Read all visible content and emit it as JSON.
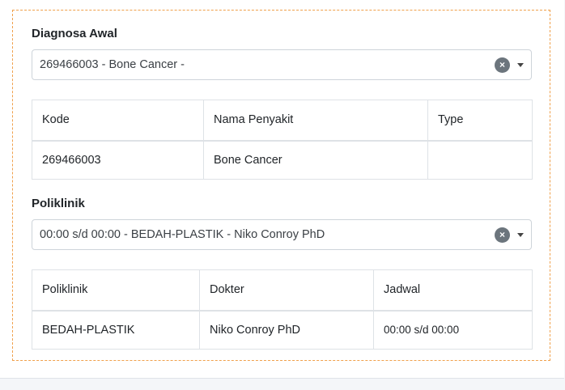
{
  "diagnosa": {
    "label": "Diagnosa Awal",
    "selected": "269466003 - Bone Cancer -",
    "table": {
      "headers": [
        "Kode",
        "Nama Penyakit",
        "Type"
      ],
      "rows": [
        [
          "269466003",
          "Bone Cancer",
          ""
        ]
      ]
    }
  },
  "poliklinik": {
    "label": "Poliklinik",
    "selected": "00:00 s/d 00:00 - BEDAH-PLASTIK - Niko Conroy PhD",
    "table": {
      "headers": [
        "Poliklinik",
        "Dokter",
        "Jadwal"
      ],
      "rows": [
        [
          "BEDAH-PLASTIK",
          "Niko Conroy PhD",
          "00:00 s/d 00:00"
        ]
      ]
    }
  },
  "controls": {
    "clear_glyph": "×"
  },
  "colors": {
    "panel_border": "#f0a04b",
    "clear_button": "#6c757d",
    "table_border": "#dee2e6"
  },
  "icons": [
    "clear-icon",
    "chevron-down-icon"
  ]
}
